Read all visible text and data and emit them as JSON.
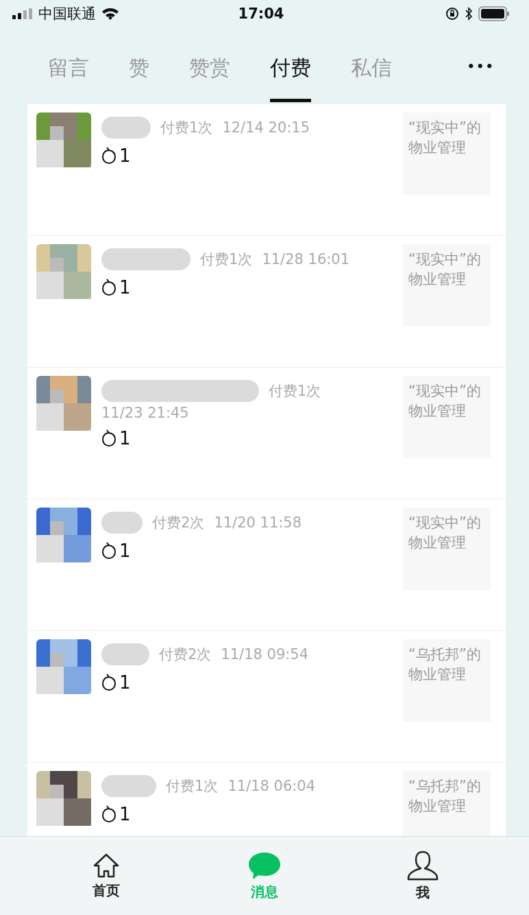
{
  "status_bar": {
    "carrier": "中国联通",
    "time": "17:04"
  },
  "tabs": [
    {
      "label": "留言",
      "selected": false
    },
    {
      "label": "赞",
      "selected": false
    },
    {
      "label": "赞赏",
      "selected": false
    },
    {
      "label": "付费",
      "selected": true
    },
    {
      "label": "私信",
      "selected": false
    }
  ],
  "more_button": "•••",
  "payments": [
    {
      "count": "付费1次",
      "time": "12/14 20:15",
      "amount": "1",
      "article": "“现实中”的物业管理"
    },
    {
      "count": "付费1次",
      "time": "11/28 16:01",
      "amount": "1",
      "article": "“现实中”的物业管理"
    },
    {
      "count": "付费1次",
      "time": "11/23 21:45",
      "amount": "1",
      "article": "“现实中”的物业管理"
    },
    {
      "count": "付费2次",
      "time": "11/20 11:58",
      "amount": "1",
      "article": "“现实中”的物业管理"
    },
    {
      "count": "付费2次",
      "time": "11/18 09:54",
      "amount": "1",
      "article": "“乌托邦”的物业管理"
    },
    {
      "count": "付费1次",
      "time": "11/18 06:04",
      "amount": "1",
      "article": "“乌托邦”的物业管理"
    }
  ],
  "bottom_nav": [
    {
      "label": "首页",
      "kind": "home",
      "selected": false
    },
    {
      "label": "消息",
      "kind": "chat",
      "selected": true
    },
    {
      "label": "我",
      "kind": "person",
      "selected": false
    }
  ]
}
